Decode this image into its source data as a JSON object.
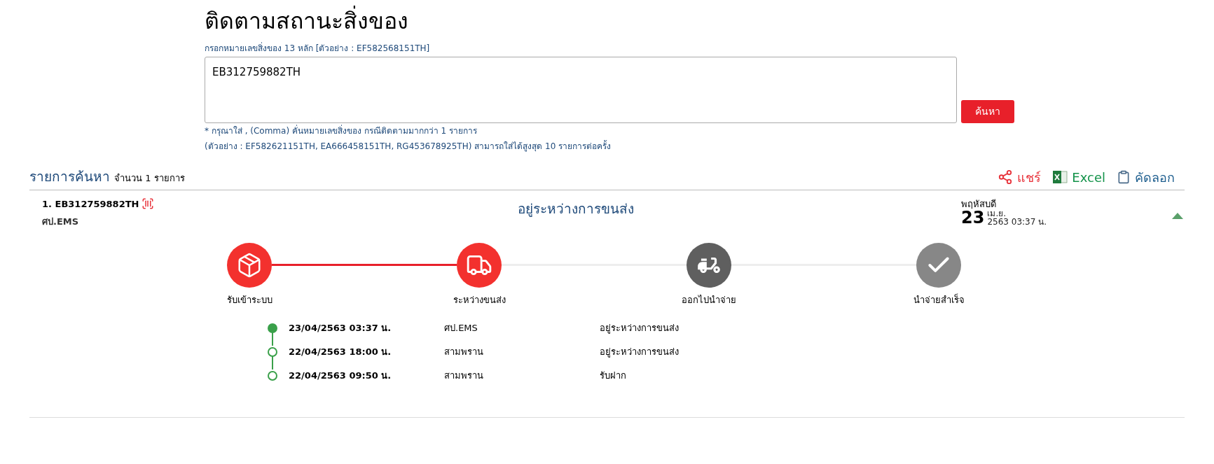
{
  "title": "ติดตามสถานะสิ่งของ",
  "form": {
    "label": "กรอกหมายเลขสิ่งของ 13 หลัก [ตัวอย่าง : EF582568151TH]",
    "value": "EB312759882TH",
    "button": "ค้นหา",
    "notes": [
      "* กรุณาใส่ , (Comma) คั่นหมายเลขสิ่งของ กรณีติดตามมากกว่า 1 รายการ",
      "(ตัวอย่าง : EF582621151TH, EA666458151TH, RG453678925TH) สามารถใส่ได้สูงสุด 10 รายการต่อครั้ง"
    ]
  },
  "results": {
    "heading": "รายการค้นหา",
    "count": "จำนวน 1 รายการ",
    "actions": [
      {
        "kind": "share",
        "label": "แชร์"
      },
      {
        "kind": "excel",
        "label": "Excel"
      },
      {
        "kind": "copy",
        "label": "คัดลอก"
      }
    ]
  },
  "item": {
    "number": "1. EB312759882TH",
    "office": "ศป.EMS",
    "status": "อยู่ระหว่างการขนส่ง",
    "weekday": "พฤหัสบดี",
    "day": "23",
    "month": "เม.ย.",
    "year_time": "2563 03:37 น.",
    "expanded": true,
    "stages": [
      {
        "kind": "box",
        "label": "รับเข้าระบบ",
        "done": true
      },
      {
        "kind": "truck",
        "label": "ระหว่างขนส่ง",
        "done": true
      },
      {
        "kind": "scooter",
        "label": "ออกไปนำจ่าย",
        "done": false
      },
      {
        "kind": "check",
        "label": "นำจ่ายสำเร็จ",
        "done": false
      }
    ],
    "events": [
      {
        "time": "23/04/2563 03:37 น.",
        "location": "ศป.EMS",
        "description": "อยู่ระหว่างการขนส่ง",
        "latest": true
      },
      {
        "time": "22/04/2563 18:00 น.",
        "location": "สามพราน",
        "description": "อยู่ระหว่างการขนส่ง",
        "latest": false
      },
      {
        "time": "22/04/2563 09:50 น.",
        "location": "สามพราน",
        "description": "รับฝาก",
        "latest": false
      }
    ]
  }
}
